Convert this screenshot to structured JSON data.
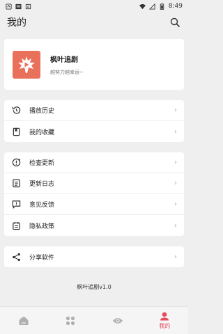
{
  "status_bar": {
    "time": "8:49"
  },
  "app_bar": {
    "title": "我的"
  },
  "profile": {
    "name": "枫叶追剧",
    "subtitle": "越努力越幸运~"
  },
  "group1": [
    {
      "label": "播放历史",
      "icon": "history-icon"
    },
    {
      "label": "我的收藏",
      "icon": "bookmark-icon"
    }
  ],
  "group2": [
    {
      "label": "检查更新",
      "icon": "update-icon"
    },
    {
      "label": "更新日志",
      "icon": "log-icon"
    },
    {
      "label": "意见反馈",
      "icon": "feedback-icon"
    },
    {
      "label": "隐私政策",
      "icon": "privacy-icon"
    }
  ],
  "group3": [
    {
      "label": "分享软件",
      "icon": "share-icon"
    }
  ],
  "version": "枫叶追剧v1.0",
  "bottom_nav": [
    {
      "icon": "home-icon",
      "label": ""
    },
    {
      "icon": "category-icon",
      "label": ""
    },
    {
      "icon": "eye-icon",
      "label": ""
    },
    {
      "icon": "profile-icon",
      "label": "我的"
    }
  ],
  "colors": {
    "accent": "#e74c5e",
    "logo_bg": "#e9705a",
    "background": "#efefef"
  }
}
